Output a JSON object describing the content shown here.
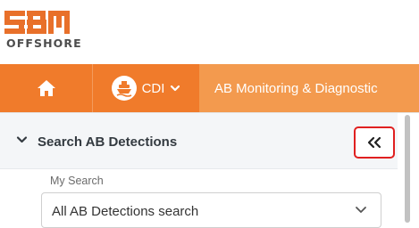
{
  "brand": {
    "logo_mark_label": "SBM",
    "logo_text": "OFFSHORE",
    "accent_color": "#f07b2b",
    "active_tab_color": "#f39a4e"
  },
  "nav": {
    "home_icon": "home-icon",
    "site_icon": "ship-icon",
    "site_label": "CDI",
    "site_chevron_icon": "chevron-down-icon",
    "active_tab_label": "AB Monitoring & Diagnostic"
  },
  "panel": {
    "title": "Search AB Detections",
    "toggle_icon": "chevron-down-icon",
    "collapse_icon": "double-chevron-left-icon",
    "field_label": "My Search",
    "selected_search": "All AB Detections search"
  }
}
